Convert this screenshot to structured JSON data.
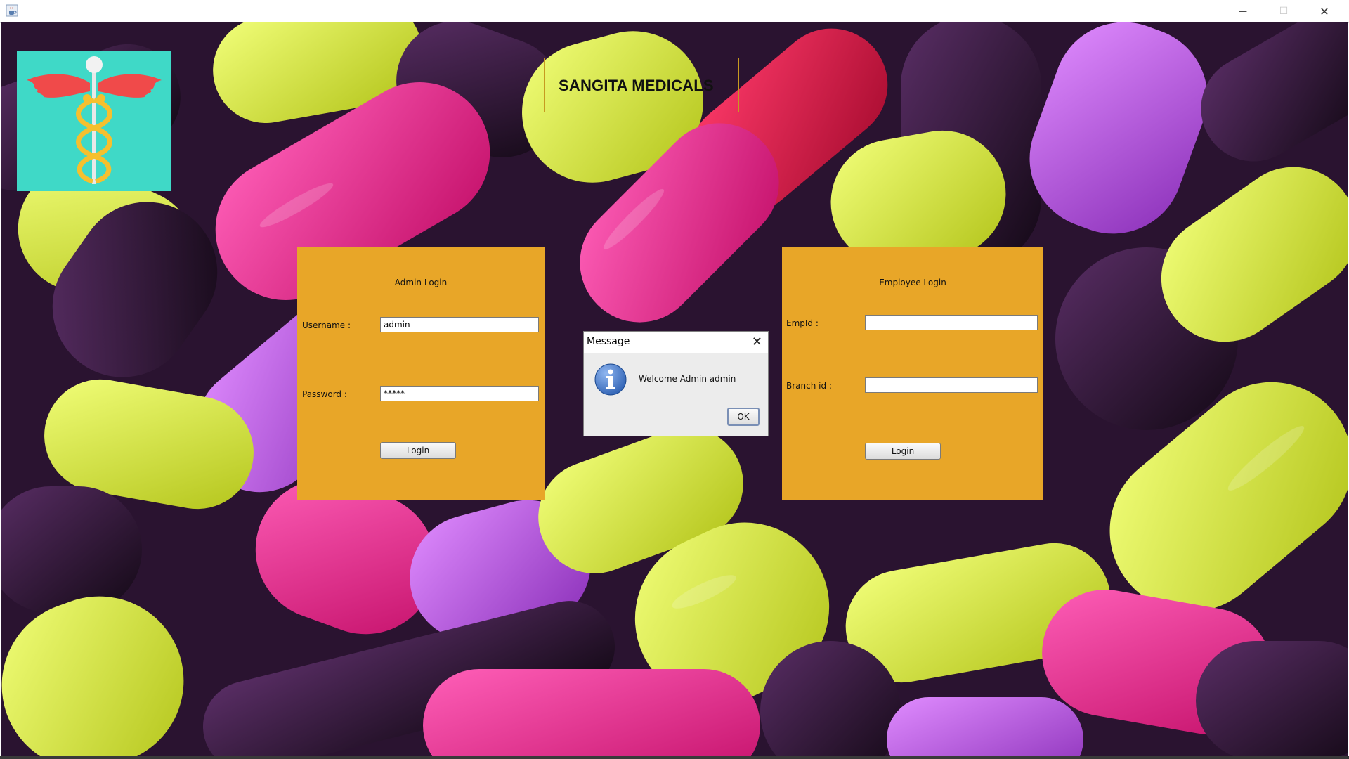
{
  "window": {
    "title": "",
    "minimize_glyph": "—",
    "maximize_glyph": "☐",
    "close_glyph": "✕"
  },
  "header": {
    "app_title": "SANGITA MEDICALS"
  },
  "admin_login": {
    "title": "Admin Login",
    "username_label": "Username :",
    "username_value": "admin",
    "password_label": "Password  :",
    "password_value": "*****",
    "login_label": "Login"
  },
  "employee_login": {
    "title": "Employee Login",
    "empid_label": "EmpId :",
    "empid_value": "",
    "branch_label": "Branch id  :",
    "branch_value": "",
    "login_label": "Login"
  },
  "dialog": {
    "title": "Message",
    "close_glyph": "✕",
    "message": "Welcome Admin admin",
    "ok_label": "OK"
  },
  "colors": {
    "panel": "#e8a628",
    "logo_bg": "#3fd9c7",
    "logo_wings": "#f04a4a",
    "logo_staff": "#f5c02e"
  },
  "icons": {
    "app": "java-cup-icon",
    "logo": "caduceus-icon",
    "dialog": "info-icon"
  }
}
